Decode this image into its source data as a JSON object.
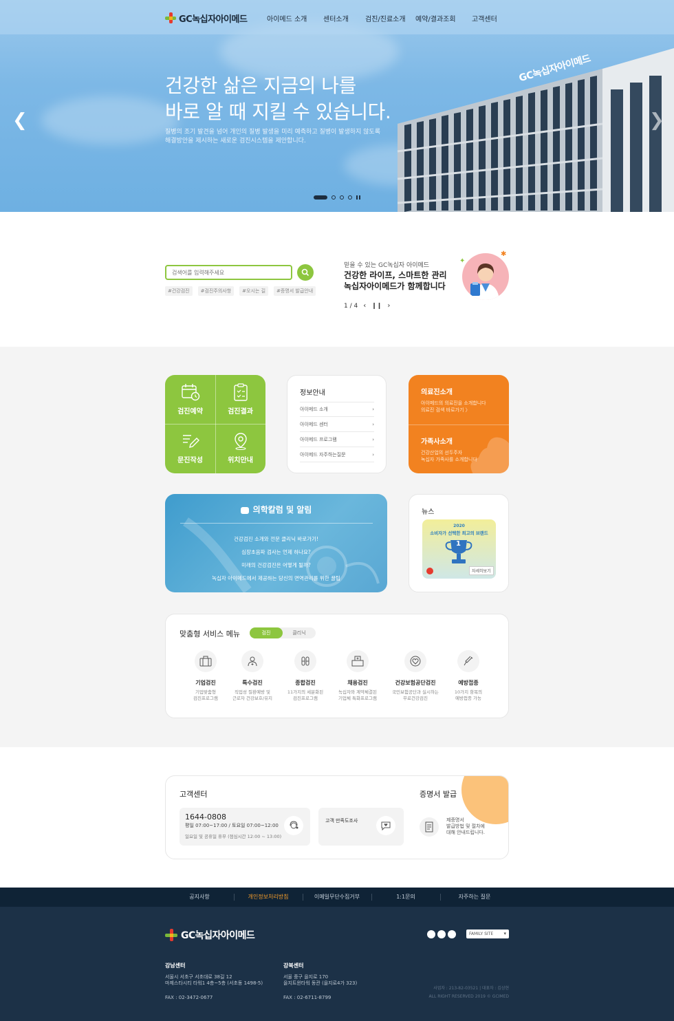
{
  "brand": {
    "name": "GC녹십자아이메드"
  },
  "nav": {
    "items": [
      "아이메드 소개",
      "센터소개",
      "검진/진료소개",
      "예약/결과조회",
      "고객센터"
    ]
  },
  "hero": {
    "title_line1": "건강한 삶은 지금의 나를",
    "title_line2": "바로 알 때 지킬 수 있습니다.",
    "subtitle_line1": "질병의 조기 발견을 넘어 개인의 질병 발생을 미리 예측하고 질병이 발생하지 않도록",
    "subtitle_line2": "해결방안을 제시하는 새로운 검진시스템을 제안합니다.",
    "building_sign": "GC녹십자아이메드",
    "slide_count": 4,
    "active_slide": 1
  },
  "search": {
    "placeholder": "검색어를 입력해주세요",
    "tags": [
      "#건강검진",
      "#검진주의사항",
      "#오시는 길",
      "#증명서 발급안내"
    ]
  },
  "promo": {
    "small": "믿을 수 있는 GC녹십자 아이메드",
    "title_line1": "건강한 라이프, 스마트한 관리",
    "title_line2": "녹십자아이메드가 함께합니다",
    "pager": "1 / 4"
  },
  "quick": {
    "items": [
      {
        "label": "검진예약",
        "icon": "calendar-icon"
      },
      {
        "label": "검진결과",
        "icon": "clipboard-icon"
      },
      {
        "label": "문진작성",
        "icon": "pencil-icon"
      },
      {
        "label": "위치안내",
        "icon": "map-pin-icon"
      }
    ]
  },
  "info": {
    "title": "정보안내",
    "items": [
      "아이메드 소개",
      "아이메드 센터",
      "아이메드 프로그램",
      "아이메드 자주하는질문"
    ]
  },
  "orange": {
    "medical_title": "의료진소개",
    "medical_desc_line1": "아이메드의 의료진을 소개합니다",
    "medical_desc_line2": "의료진 검색 바로가기 〉",
    "family_title": "가족사소개",
    "family_desc_line1": "건강산업의 선두주자",
    "family_desc_line2": "녹십자 가족사를 소개합니다"
  },
  "column": {
    "title": "의학칼럼 및 알림",
    "items": [
      "건강검진 소개와 전문 클리닉 바로가기!",
      "심장초음파 검사는 언제 하나요?",
      "미래의 건강검진은 어떻게 될까?",
      "녹십자 아이메드에서 제공하는 당신의 면역관리를 위한 꿀팁"
    ]
  },
  "news": {
    "title": "뉴스",
    "badge_year": "2020",
    "badge_text": "소비자가 선택한 최고의 브랜드",
    "badge_rank": "1",
    "more": "자세히보기"
  },
  "services": {
    "title": "맞춤형 서비스 메뉴",
    "tabs": [
      "검진",
      "클리닉"
    ],
    "items": [
      {
        "name": "기업검진",
        "desc1": "기업맞춤형",
        "desc2": "검진프로그램",
        "icon": "briefcase-icon"
      },
      {
        "name": "특수검진",
        "desc1": "직업성 질환예방 및",
        "desc2": "근로자 건강보호/유지",
        "icon": "worker-icon"
      },
      {
        "name": "종합검진",
        "desc1": "11가지의 세분화된",
        "desc2": "검진프로그램",
        "icon": "test-tubes-icon"
      },
      {
        "name": "채용검진",
        "desc1": "녹십자와 계약체결된",
        "desc2": "기업체 특화프로그램",
        "icon": "hospital-icon"
      },
      {
        "name": "건강보험공단검진",
        "desc1": "국민보험공단과 실시하는",
        "desc2": "무료건강검진",
        "icon": "heart-icon"
      },
      {
        "name": "예방접종",
        "desc1": "10가지 항목의",
        "desc2": "예방접종 가능",
        "icon": "syringe-icon"
      }
    ]
  },
  "customer": {
    "title": "고객센터",
    "phone": "1644-0808",
    "hours": "평일 07:00~17:00 / 토요일 07:00~12:00",
    "holiday": "일요일 및 공휴일 휴무 (점심시간 12:00 ~ 13:00)",
    "survey": "고객 만족도조사",
    "cert_title": "증명서 발급",
    "cert_desc_line1": "제증명서",
    "cert_desc_line2": "발급방법 및 절차에",
    "cert_desc_line3": "대해 안내드립니다."
  },
  "footer_nav": {
    "items": [
      "공지사항",
      "개인정보처리방침",
      "이메일무단수집거부",
      "1:1문의",
      "자주하는 질문"
    ],
    "highlight_color": "#f29b2a"
  },
  "footer": {
    "family_site": "FAMILY SITE",
    "gangnam_title": "강남센터",
    "gangnam_addr1": "서울시 서초구 서초대로 38길 12",
    "gangnam_addr2": "마제스타시티 타워1 4층~5층 (서초동 1498-5)",
    "gangnam_fax": "FAX : 02-3472-0677",
    "gangbuk_title": "강북센터",
    "gangbuk_addr1": "서울 중구 을지로 170",
    "gangbuk_addr2": "을지트윈타워 동관 (을지로4가 323)",
    "gangbuk_fax": "FAX : 02-6711-8799",
    "biz_no": "사업자 : 213-82-03521  |  대표자 : 김상현",
    "copyright": "ALL RIGHT RESERVED 2019 © GCIMED"
  },
  "colors": {
    "green": "#8dc63f",
    "orange": "#f28220",
    "navy": "#1c3147",
    "blue": "#4aa3d2"
  }
}
